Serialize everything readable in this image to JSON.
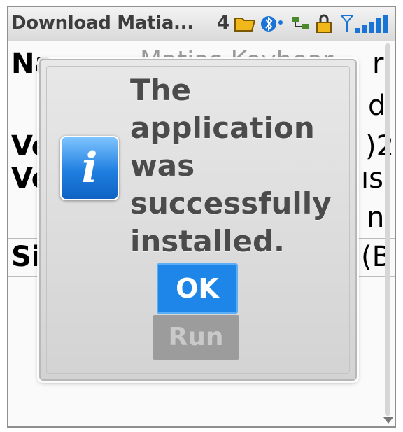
{
  "status_bar": {
    "title": "Download Matia...",
    "count": "4"
  },
  "background": {
    "rows": [
      {
        "prefix": "Na",
        "suffix": "r"
      },
      {
        "prefix": "",
        "suffix": "d"
      },
      {
        "prefix": "Ve",
        "suffix": ")2"
      },
      {
        "prefix": "Ve",
        "suffix": "ıs"
      },
      {
        "prefix": "",
        "suffix": "n"
      },
      {
        "prefix": "Si",
        "suffix": "(B"
      }
    ],
    "faded_text": "Matias Koyhoar"
  },
  "dialog": {
    "message": "The application was successfully installed.",
    "icon_letter": "i",
    "ok_label": "OK",
    "run_label": "Run"
  },
  "colors": {
    "ok_button": "#1e86e8",
    "run_button": "#9c9c9c",
    "info_icon": "#1f7fe0",
    "message_text": "#4b4b4b"
  }
}
